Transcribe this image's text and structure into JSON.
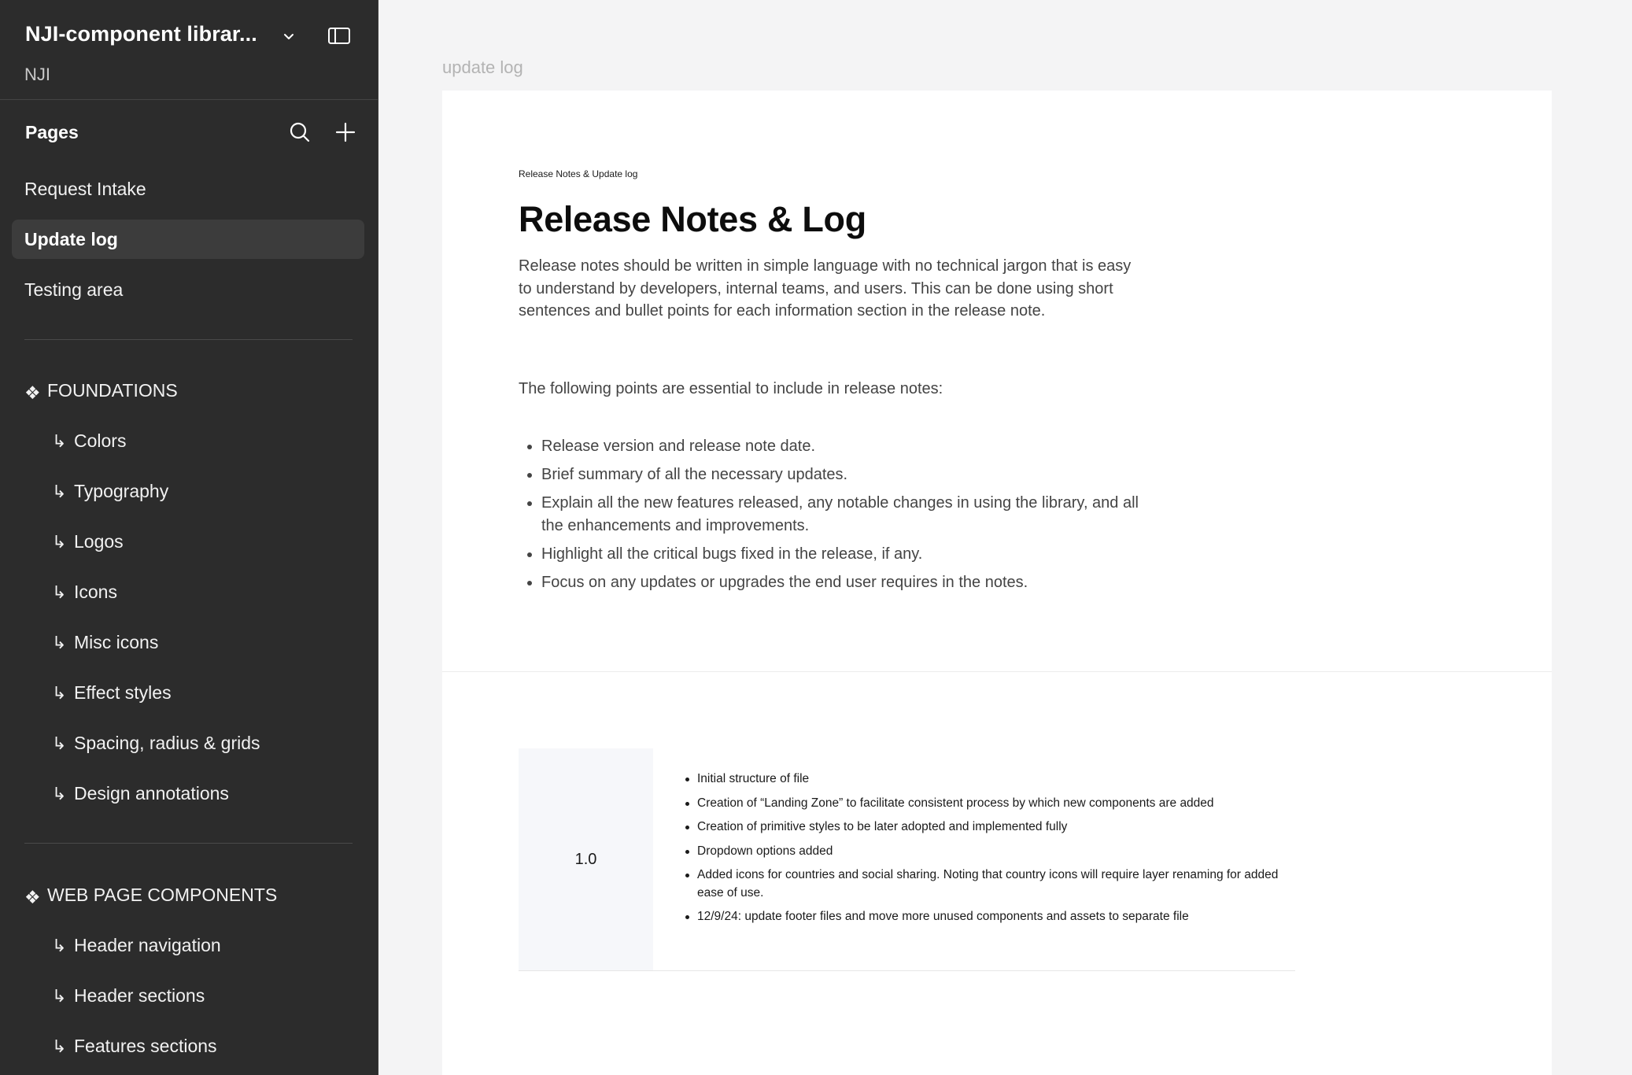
{
  "sidebar": {
    "file_title": "NJI-component librar...",
    "team_name": "NJI",
    "pages_label": "Pages",
    "pages": [
      {
        "label": "Request Intake",
        "active": false
      },
      {
        "label": "Update log",
        "active": true
      },
      {
        "label": "Testing area",
        "active": false
      }
    ],
    "foundations": {
      "title": "FOUNDATIONS",
      "items": [
        "Colors",
        "Typography",
        "Logos",
        "Icons",
        "Misc icons",
        "Effect styles",
        "Spacing, radius & grids",
        "Design annotations"
      ]
    },
    "web_components": {
      "title": "WEB PAGE COMPONENTS",
      "items": [
        "Header navigation",
        "Header sections",
        "Features sections"
      ]
    },
    "sub_arrow": "↳",
    "section_glyph": "❖"
  },
  "canvas": {
    "frame_label": "update log",
    "kicker": "Release Notes & Update log",
    "title": "Release Notes & Log",
    "intro": "Release notes should be written in simple language with no technical jargon that is easy to understand by developers, internal teams, and users. This can be done using short sentences and bullet points for each information section in the release note.",
    "lead": "The following points are essential to include in release notes:",
    "essentials": [
      "Release version and release note date.",
      "Brief summary of all the necessary updates.",
      "Explain all the new features released, any notable changes in using the library, and all the enhancements and improvements.",
      "Highlight all the critical bugs fixed in the release, if any.",
      "Focus on any updates or upgrades the end user requires in the notes."
    ],
    "version": "1.0",
    "changes": [
      "Initial structure of file",
      "Creation of “Landing Zone” to facilitate consistent process by which new components are added",
      "Creation of primitive styles to be later adopted and implemented fully",
      "Dropdown options added",
      "Added icons for countries and social sharing. Noting that country icons will require layer renaming for added ease of use.",
      "12/9/24: update footer files and move more unused components and assets to separate file"
    ]
  }
}
